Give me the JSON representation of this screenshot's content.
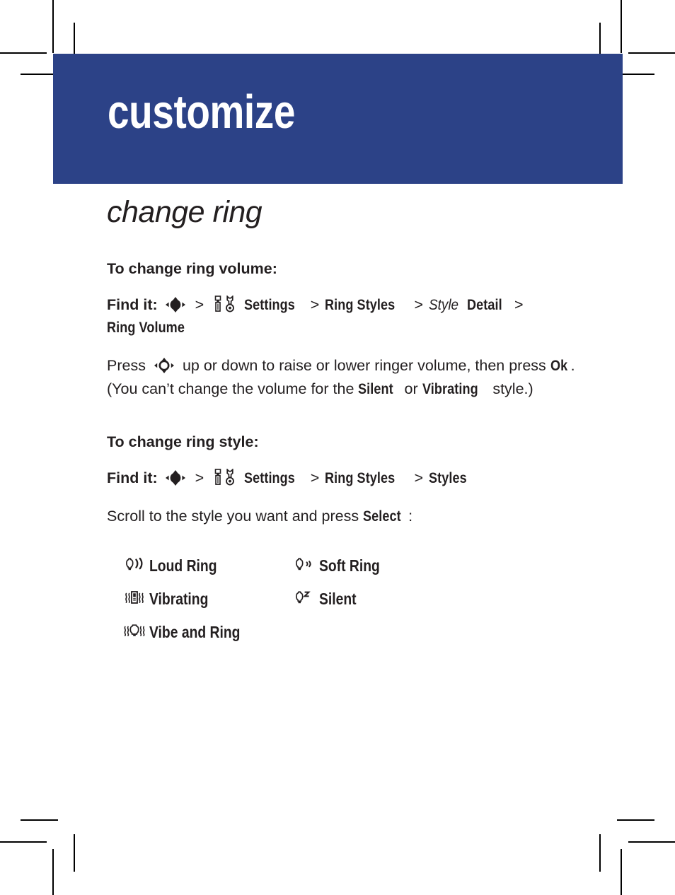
{
  "page": {
    "banner_title": "customize",
    "banner_color": "#2c4287",
    "text_color": "#231f20"
  },
  "section": {
    "title": "change ring"
  },
  "volume": {
    "subhead": "To change ring volume:",
    "findit_label": "Find it:",
    "nav_icon": "navigation-key-filled-icon",
    "sep": ">",
    "settings_icon": "settings-tools-icon",
    "crumb_settings": "Settings",
    "crumb_ring_styles": "Ring Styles",
    "crumb_style_italic": "Style",
    "crumb_detail": "Detail",
    "crumb_ring_volume": "Ring Volume",
    "body_pre": "Press",
    "press_nav_icon": "navigation-key-hollow-icon",
    "body_mid": "up or down to raise or lower ringer volume, then press",
    "key_ok": "Ok",
    "body_after_ok": ". (You can’t change the volume for the",
    "style_silent": "Silent",
    "body_or": "or",
    "style_vibrating": "Vibrating",
    "body_end": "style.)"
  },
  "style": {
    "subhead": "To change ring style:",
    "findit_label": "Find it:",
    "nav_icon": "navigation-key-filled-icon",
    "sep": ">",
    "settings_icon": "settings-tools-icon",
    "crumb_settings": "Settings",
    "crumb_ring_styles": "Ring Styles",
    "crumb_styles": "Styles",
    "instruction_pre": "Scroll to the style you want and press",
    "key_select": "Select",
    "instruction_post": ":"
  },
  "ring_styles": [
    {
      "icon": "bell-loud-ring-icon",
      "label": "Loud Ring"
    },
    {
      "icon": "phone-vibrating-icon",
      "label": "Vibrating"
    },
    {
      "icon": "bell-vibe-ring-icon",
      "label": "Vibe and Ring"
    },
    {
      "icon": "bell-soft-ring-icon",
      "label": "Soft Ring"
    },
    {
      "icon": "bell-silent-icon",
      "label": "Silent"
    }
  ]
}
